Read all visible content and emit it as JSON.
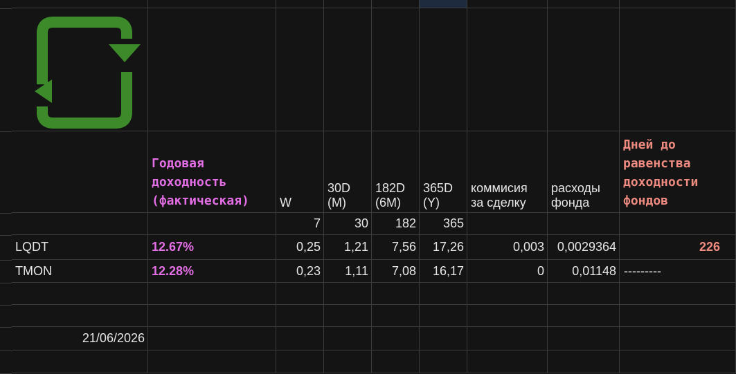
{
  "header": {
    "annual_yield": "Годовая доходность (фактическая)",
    "w": "W",
    "d30": "30D (M)",
    "d182": "182D (6M)",
    "d365": "365D (Y)",
    "commission": "коммисия за сделку",
    "expenses": "расходы фонда",
    "days_parity": "Дней до равенства доходности фондов"
  },
  "days_row": {
    "w": "7",
    "d30": "30",
    "d182": "182",
    "d365": "365"
  },
  "funds": [
    {
      "ticker": "LQDT",
      "yield": "12.67%",
      "w": "0,25",
      "d30": "1,21",
      "d182": "7,56",
      "d365": "17,26",
      "commission": "0,003",
      "expenses": "0,0029364",
      "days": "226"
    },
    {
      "ticker": "TMON",
      "yield": "12.28%",
      "w": "0,23",
      "d30": "1,11",
      "d182": "7,08",
      "d365": "16,17",
      "commission": "0",
      "expenses": "0,01148",
      "days": "---------"
    }
  ],
  "date": "21/06/2026",
  "colors": {
    "logo": "#3c8a2a",
    "pink": "#e46ee6",
    "salmon": "#ef8b80",
    "background": "#141414"
  },
  "icons": {
    "logo": "refresh-icon"
  }
}
